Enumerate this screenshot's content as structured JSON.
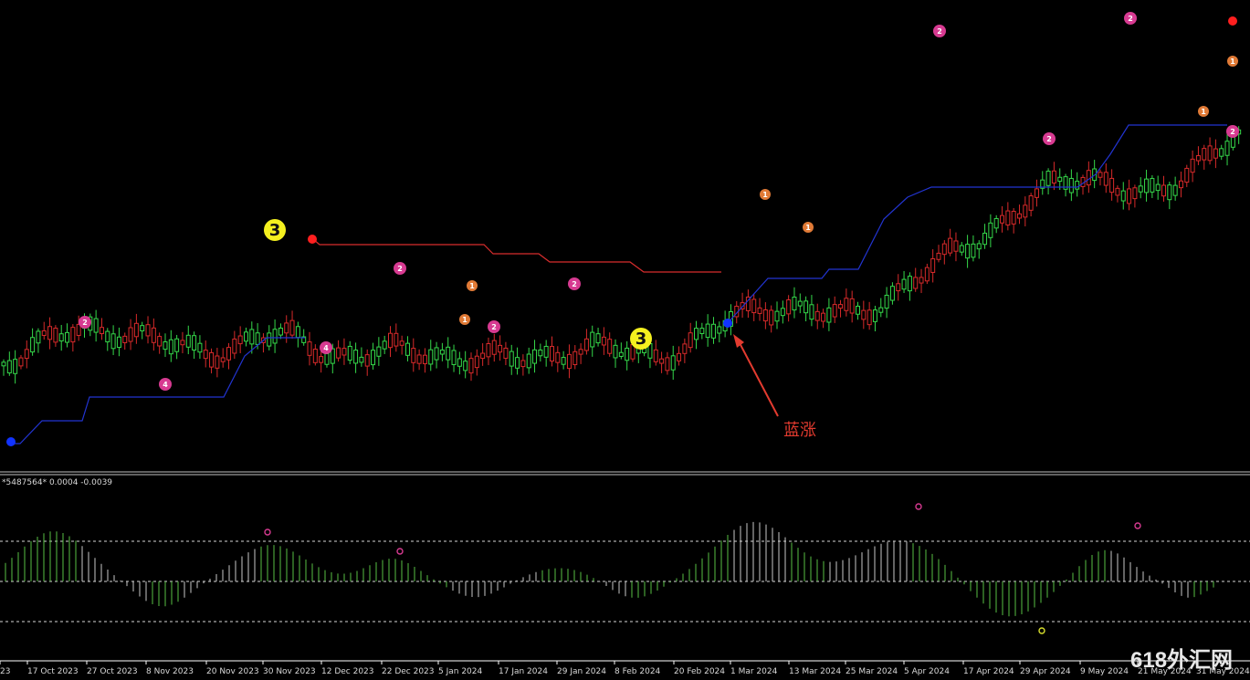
{
  "chart_data": {
    "type": "candlestick",
    "title": "",
    "indicator_label": "*5487564* 0.0004 -0.0039",
    "annotation_text": "蓝涨",
    "watermark": "618外汇网",
    "x_ticks": [
      "23",
      "17 Oct 2023",
      "27 Oct 2023",
      "8 Nov 2023",
      "20 Nov 2023",
      "30 Nov 2023",
      "12 Dec 2023",
      "22 Dec 2023",
      "5 Jan 2024",
      "17 Jan 2024",
      "29 Jan 2024",
      "8 Feb 2024",
      "20 Feb 2024",
      "1 Mar 2024",
      "13 Mar 2024",
      "25 Mar 2024",
      "5 Apr 2024",
      "17 Apr 2024",
      "29 Apr 2024",
      "9 May 2024",
      "21 May 2024",
      "31 May 2024"
    ],
    "main_series": [
      {
        "name": "price",
        "color_up": "#35d84a",
        "color_down": "#d72a2a"
      },
      {
        "name": "signal_line_blue",
        "color": "#2234d1"
      },
      {
        "name": "signal_line_red",
        "color": "#d82d2d"
      }
    ],
    "subchart": {
      "type": "histogram",
      "series": [
        {
          "name": "positive",
          "color": "#58c145"
        },
        {
          "name": "negative",
          "color": "#c8c8c8"
        }
      ]
    }
  }
}
